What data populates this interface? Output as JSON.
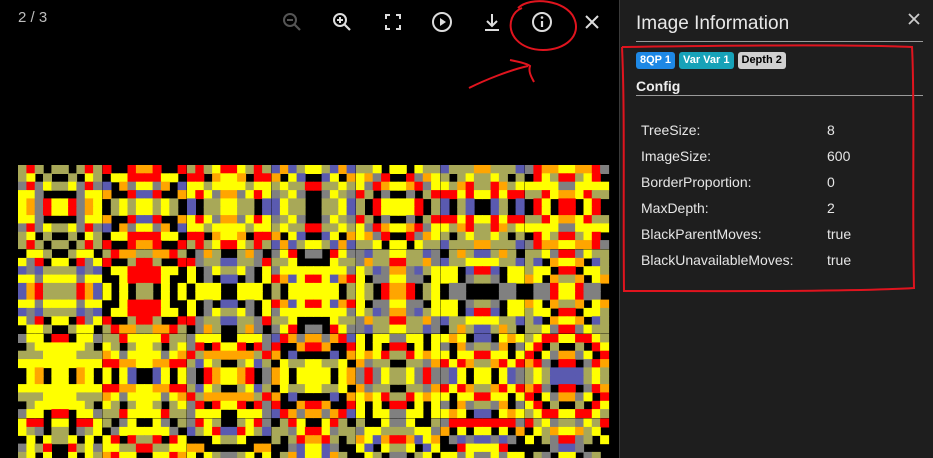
{
  "viewer": {
    "counter": "2 / 3",
    "toolbar": [
      {
        "icon": "zoom-out-icon"
      },
      {
        "icon": "zoom-in-icon"
      },
      {
        "icon": "fullscreen-icon"
      },
      {
        "icon": "play-icon"
      },
      {
        "icon": "download-icon"
      },
      {
        "icon": "info-icon"
      },
      {
        "icon": "close-icon"
      }
    ],
    "palette": [
      "#ffff00",
      "#ff0000",
      "#ffa500",
      "#5a5ab0",
      "#a8a858",
      "#808080",
      "#000000"
    ]
  },
  "panel": {
    "title": "Image Information",
    "badges": [
      "8QP 1",
      "Var Var 1",
      "Depth 2"
    ],
    "section": "Config",
    "config": [
      {
        "key": "TreeSize:",
        "value": "8"
      },
      {
        "key": "ImageSize:",
        "value": "600"
      },
      {
        "key": "BorderProportion:",
        "value": "0"
      },
      {
        "key": "MaxDepth:",
        "value": "2"
      },
      {
        "key": "BlackParentMoves:",
        "value": "true"
      },
      {
        "key": "BlackUnavailableMoves:",
        "value": "true"
      }
    ]
  },
  "annotation_color": "#e0141e"
}
